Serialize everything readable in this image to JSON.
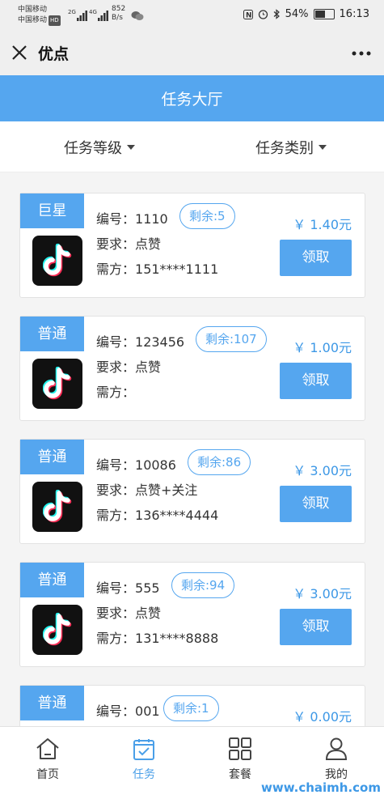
{
  "statusbar": {
    "carrier1": "中国移动",
    "carrier2": "中国移动",
    "hd": "HD",
    "net1": "2G",
    "net2": "4G",
    "speed_value": "852",
    "speed_unit": "B/s",
    "battery": "54%",
    "time": "16:13"
  },
  "titlebar": {
    "title": "优点"
  },
  "banner": {
    "title": "任务大厅"
  },
  "filters": {
    "level": "任务等级",
    "type": "任务类别"
  },
  "task_labels": {
    "number": "编号：",
    "requirement": "要求：",
    "requester": "需方：",
    "claim": "领取"
  },
  "tasks": [
    {
      "grade": "巨星",
      "number": "1110",
      "remaining": "剩余:5",
      "requirement": "点赞",
      "requester": "151****1111",
      "price": "￥ 1.40元"
    },
    {
      "grade": "普通",
      "number": "123456",
      "remaining": "剩余:107",
      "requirement": "点赞",
      "requester": "",
      "price": "￥ 1.00元"
    },
    {
      "grade": "普通",
      "number": "10086",
      "remaining": "剩余:86",
      "requirement": "点赞+关注",
      "requester": "136****4444",
      "price": "￥ 3.00元"
    },
    {
      "grade": "普通",
      "number": "555",
      "remaining": "剩余:94",
      "requirement": "点赞",
      "requester": "131****8888",
      "price": "￥ 3.00元"
    },
    {
      "grade": "普通",
      "number": "001",
      "remaining": "剩余:1",
      "requirement": "",
      "requester": "",
      "price": "￥ 0.00元"
    }
  ],
  "nav": [
    {
      "label": "首页",
      "icon": "home-icon",
      "active": false
    },
    {
      "label": "任务",
      "icon": "task-icon",
      "active": true
    },
    {
      "label": "套餐",
      "icon": "grid-icon",
      "active": false
    },
    {
      "label": "我的",
      "icon": "user-icon",
      "active": false
    }
  ],
  "colors": {
    "accent": "#55a6ef",
    "price": "#3d98e6"
  },
  "watermark": "www.chaimh.com"
}
